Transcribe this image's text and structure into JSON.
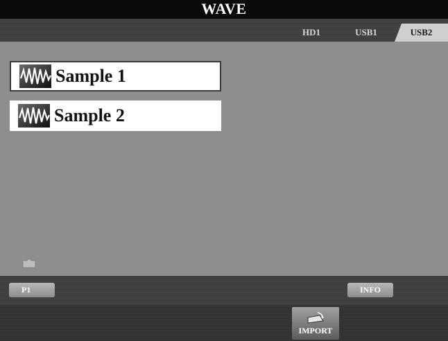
{
  "window": {
    "title": "WAVE"
  },
  "tabs": [
    {
      "label": "HD1",
      "selected": false
    },
    {
      "label": "USB1",
      "selected": false
    },
    {
      "label": "USB2",
      "selected": true
    }
  ],
  "files": [
    {
      "label": "Sample 1",
      "icon": "wave-file-icon",
      "selected": true
    },
    {
      "label": "Sample 2",
      "icon": "wave-file-icon",
      "selected": false
    }
  ],
  "footer": {
    "page_label": "P1",
    "info_label": "INFO",
    "import_label": "IMPORT",
    "import_icon": "import-icon"
  },
  "colors": {
    "background": "#8e8e8e",
    "title_bar": "#0a0a0a",
    "selected_tab": "#cfcfcf"
  }
}
